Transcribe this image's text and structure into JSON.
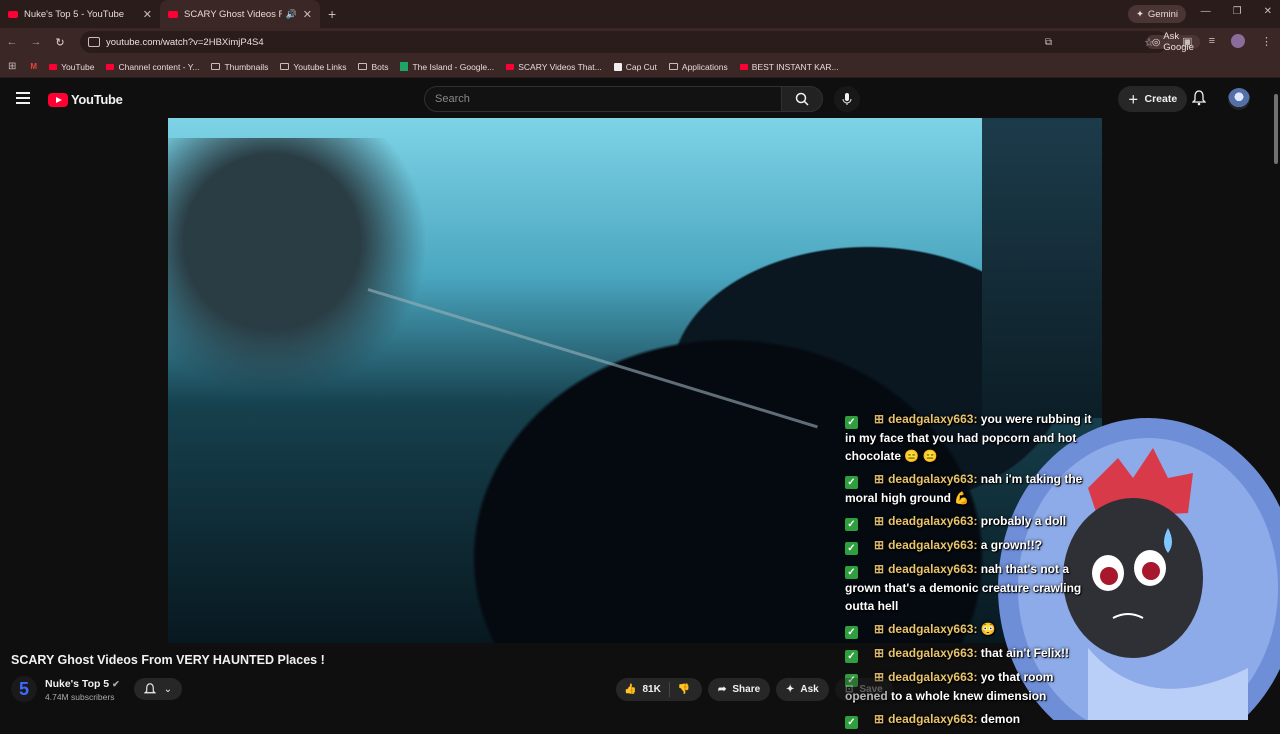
{
  "browser": {
    "tabs": [
      {
        "title": "Nuke's Top 5 - YouTube",
        "active": false
      },
      {
        "title": "SCARY Ghost Videos From VERY",
        "active": true
      }
    ],
    "gemini_label": "Gemini",
    "url": "youtube.com/watch?v=2HBXimjP4S4",
    "ask_google_label": "Ask Google",
    "bookmarks": [
      {
        "label": "",
        "icon": "gmail-icon"
      },
      {
        "label": "YouTube",
        "icon": "youtube-icon"
      },
      {
        "label": "Channel content - Y...",
        "icon": "youtube-icon"
      },
      {
        "label": "Thumbnails",
        "icon": "folder-icon"
      },
      {
        "label": "Youtube Links",
        "icon": "folder-icon"
      },
      {
        "label": "Bots",
        "icon": "folder-icon"
      },
      {
        "label": "The Island - Google...",
        "icon": "sheets-icon"
      },
      {
        "label": "SCARY Videos That...",
        "icon": "youtube-icon"
      },
      {
        "label": "Cap Cut",
        "icon": "capcut-icon"
      },
      {
        "label": "Applications",
        "icon": "folder-icon"
      },
      {
        "label": "BEST INSTANT KAR...",
        "icon": "youtube-icon"
      }
    ]
  },
  "youtube": {
    "logo_text": "YouTube",
    "search_placeholder": "Search",
    "create_label": "Create"
  },
  "chat": [
    {
      "user": "deadgalaxy663:",
      "text": "you were rubbing it in my face that you had popcorn and hot chocolate 😑 😑"
    },
    {
      "user": "deadgalaxy663:",
      "text": "nah i'm taking the moral high ground 💪"
    },
    {
      "user": "deadgalaxy663:",
      "text": "probably a doll"
    },
    {
      "user": "deadgalaxy663:",
      "text": "a grown!!?"
    },
    {
      "user": "deadgalaxy663:",
      "text": "nah that's not a grown that's a demonic creature crawling outta hell"
    },
    {
      "user": "deadgalaxy663:",
      "text": "😳"
    },
    {
      "user": "deadgalaxy663:",
      "text": "that ain't Felix!!"
    },
    {
      "user": "deadgalaxy663:",
      "text": "yo that room opened to a whole knew dimension"
    },
    {
      "user": "deadgalaxy663:",
      "text": "demon"
    }
  ],
  "video": {
    "title": "SCARY Ghost Videos From VERY HAUNTED Places !",
    "channel": "Nuke's Top 5",
    "subscribers": "4.74M subscribers",
    "likes": "81K",
    "share_label": "Share",
    "ask_label": "Ask",
    "save_label": "Save"
  },
  "colors": {
    "accent": "#ff0033",
    "chrome": "#3c2727",
    "page_bg": "#0f0f0f"
  }
}
